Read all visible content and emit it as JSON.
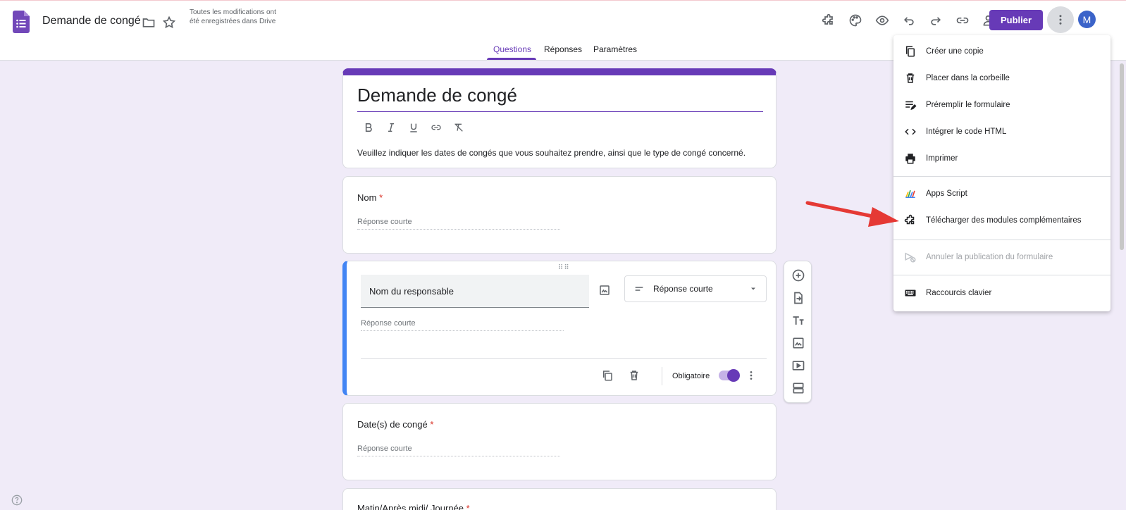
{
  "header": {
    "doc_title": "Demande de congé",
    "save_status": "Toutes les modifications ont été enregistrées dans Drive",
    "publish_label": "Publier",
    "avatar_letter": "M"
  },
  "tabs": [
    {
      "label": "Questions",
      "active": true
    },
    {
      "label": "Réponses",
      "active": false
    },
    {
      "label": "Paramètres",
      "active": false
    }
  ],
  "form": {
    "title": "Demande de congé",
    "description": "Veuillez indiquer les dates de congés que vous souhaitez prendre, ainsi que le type de congé concerné.",
    "questions": [
      {
        "label": "Nom",
        "required": "*",
        "placeholder": "Réponse courte"
      },
      {
        "label": "Nom du responsable",
        "type": "Réponse courte",
        "placeholder": "Réponse courte",
        "required_label": "Obligatoire"
      },
      {
        "label": "Date(s) de congé",
        "required": "*",
        "placeholder": "Réponse courte"
      },
      {
        "label": "Matin/Après midi/ Journée",
        "required": "*"
      }
    ]
  },
  "menu": {
    "items": [
      {
        "label": "Créer une copie",
        "icon": "copy-icon"
      },
      {
        "label": "Placer dans la corbeille",
        "icon": "trash-icon"
      },
      {
        "label": "Préremplir le formulaire",
        "icon": "prefill-icon"
      },
      {
        "label": "Intégrer le code HTML",
        "icon": "code-icon"
      },
      {
        "label": "Imprimer",
        "icon": "print-icon"
      },
      {
        "label": "Apps Script",
        "icon": "apps-script-icon"
      },
      {
        "label": "Télécharger des modules complémentaires",
        "icon": "puzzle-icon"
      },
      {
        "label": "Annuler la publication du formulaire",
        "icon": "unpublish-icon",
        "disabled": true
      },
      {
        "label": "Raccourcis clavier",
        "icon": "keyboard-icon"
      }
    ]
  },
  "colors": {
    "accent": "#673ab7",
    "background": "#f0ebf8",
    "question_highlight": "#4285f4",
    "required": "#d93025",
    "arrow": "#e53935"
  }
}
